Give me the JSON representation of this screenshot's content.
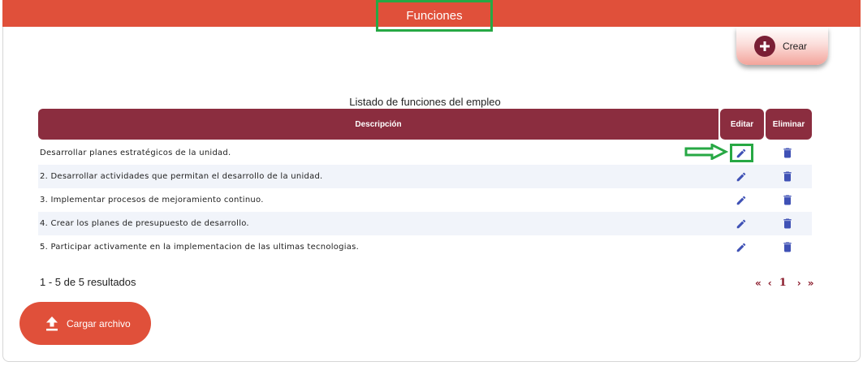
{
  "header": {
    "title": "Funciones",
    "bg_color": "#e0503a"
  },
  "create_button": {
    "label": "Crear",
    "icon": "plus-circle-icon"
  },
  "table": {
    "title": "Listado de funciones del empleo",
    "columns": [
      "Descripción",
      "Editar",
      "Eliminar"
    ],
    "header_color": "#8b2d3f",
    "rows": [
      {
        "description": "Desarrollar planes estratégicos de la unidad.",
        "edit_icon": "pencil-icon",
        "delete_icon": "trash-icon"
      },
      {
        "description": "2. Desarrollar actividades que permitan el desarrollo de la unidad.",
        "edit_icon": "pencil-icon",
        "delete_icon": "trash-icon"
      },
      {
        "description": "3. Implementar procesos de mejoramiento continuo.",
        "edit_icon": "pencil-icon",
        "delete_icon": "trash-icon"
      },
      {
        "description": "4. Crear los planes de presupuesto de desarrollo.",
        "edit_icon": "pencil-icon",
        "delete_icon": "trash-icon"
      },
      {
        "description": "5. Participar activamente en la implementacion de las ultimas tecnologias.",
        "edit_icon": "pencil-icon",
        "delete_icon": "trash-icon"
      }
    ]
  },
  "pagination": {
    "summary": "1 - 5 de 5 resultados",
    "first": "«",
    "prev": "‹",
    "current_page": "1",
    "next": "›",
    "last": "»"
  },
  "upload_button": {
    "label": "Cargar archivo",
    "icon": "upload-icon"
  },
  "annotations": {
    "highlight_color": "#27a844",
    "arrow_icon": "arrow-right-icon"
  }
}
